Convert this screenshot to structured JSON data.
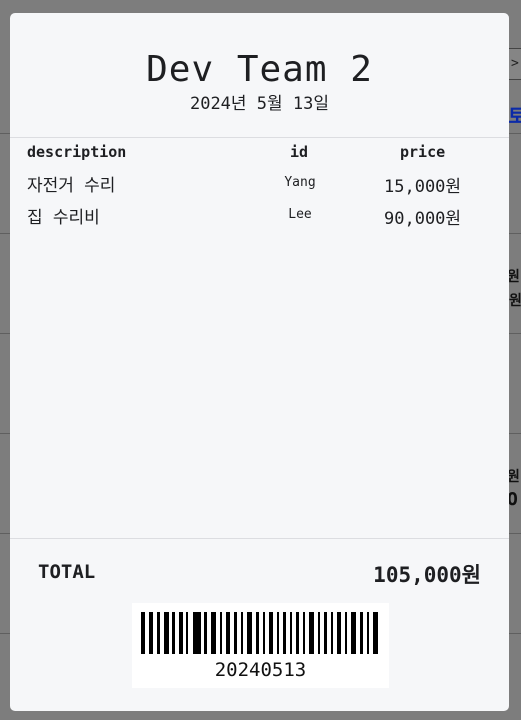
{
  "receipt": {
    "title": "Dev Team 2",
    "date": "2024년 5월 13일",
    "columns": {
      "description": "description",
      "id": "id",
      "price": "price"
    },
    "items": [
      {
        "description": "자전거 수리",
        "id": "Yang",
        "price": "15,000원"
      },
      {
        "description": "집 수리비",
        "id": "Lee",
        "price": "90,000원"
      }
    ],
    "total_label": "TOTAL",
    "total_value": "105,000원",
    "barcode_number": "20240513"
  },
  "background": {
    "arrow": ">",
    "right_link_fragment": "토",
    "right_fragments": [
      "원:",
      "원",
      "원:",
      "O"
    ]
  },
  "icons": [
    "chevron-right-icon",
    "barcode-icon"
  ]
}
